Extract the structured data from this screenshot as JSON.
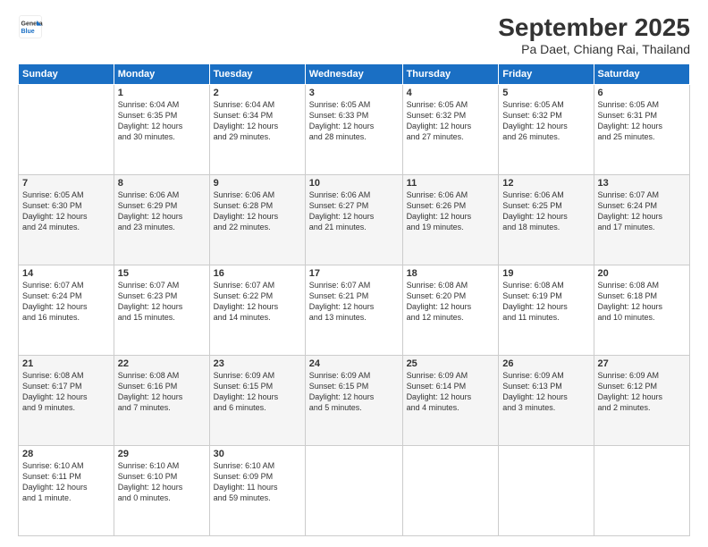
{
  "header": {
    "logo": {
      "line1": "General",
      "line2": "Blue"
    },
    "title": "September 2025",
    "subtitle": "Pa Daet, Chiang Rai, Thailand"
  },
  "days_of_week": [
    "Sunday",
    "Monday",
    "Tuesday",
    "Wednesday",
    "Thursday",
    "Friday",
    "Saturday"
  ],
  "weeks": [
    [
      {
        "day": "",
        "info": ""
      },
      {
        "day": "1",
        "info": "Sunrise: 6:04 AM\nSunset: 6:35 PM\nDaylight: 12 hours\nand 30 minutes."
      },
      {
        "day": "2",
        "info": "Sunrise: 6:04 AM\nSunset: 6:34 PM\nDaylight: 12 hours\nand 29 minutes."
      },
      {
        "day": "3",
        "info": "Sunrise: 6:05 AM\nSunset: 6:33 PM\nDaylight: 12 hours\nand 28 minutes."
      },
      {
        "day": "4",
        "info": "Sunrise: 6:05 AM\nSunset: 6:32 PM\nDaylight: 12 hours\nand 27 minutes."
      },
      {
        "day": "5",
        "info": "Sunrise: 6:05 AM\nSunset: 6:32 PM\nDaylight: 12 hours\nand 26 minutes."
      },
      {
        "day": "6",
        "info": "Sunrise: 6:05 AM\nSunset: 6:31 PM\nDaylight: 12 hours\nand 25 minutes."
      }
    ],
    [
      {
        "day": "7",
        "info": "Sunrise: 6:05 AM\nSunset: 6:30 PM\nDaylight: 12 hours\nand 24 minutes."
      },
      {
        "day": "8",
        "info": "Sunrise: 6:06 AM\nSunset: 6:29 PM\nDaylight: 12 hours\nand 23 minutes."
      },
      {
        "day": "9",
        "info": "Sunrise: 6:06 AM\nSunset: 6:28 PM\nDaylight: 12 hours\nand 22 minutes."
      },
      {
        "day": "10",
        "info": "Sunrise: 6:06 AM\nSunset: 6:27 PM\nDaylight: 12 hours\nand 21 minutes."
      },
      {
        "day": "11",
        "info": "Sunrise: 6:06 AM\nSunset: 6:26 PM\nDaylight: 12 hours\nand 19 minutes."
      },
      {
        "day": "12",
        "info": "Sunrise: 6:06 AM\nSunset: 6:25 PM\nDaylight: 12 hours\nand 18 minutes."
      },
      {
        "day": "13",
        "info": "Sunrise: 6:07 AM\nSunset: 6:24 PM\nDaylight: 12 hours\nand 17 minutes."
      }
    ],
    [
      {
        "day": "14",
        "info": "Sunrise: 6:07 AM\nSunset: 6:24 PM\nDaylight: 12 hours\nand 16 minutes."
      },
      {
        "day": "15",
        "info": "Sunrise: 6:07 AM\nSunset: 6:23 PM\nDaylight: 12 hours\nand 15 minutes."
      },
      {
        "day": "16",
        "info": "Sunrise: 6:07 AM\nSunset: 6:22 PM\nDaylight: 12 hours\nand 14 minutes."
      },
      {
        "day": "17",
        "info": "Sunrise: 6:07 AM\nSunset: 6:21 PM\nDaylight: 12 hours\nand 13 minutes."
      },
      {
        "day": "18",
        "info": "Sunrise: 6:08 AM\nSunset: 6:20 PM\nDaylight: 12 hours\nand 12 minutes."
      },
      {
        "day": "19",
        "info": "Sunrise: 6:08 AM\nSunset: 6:19 PM\nDaylight: 12 hours\nand 11 minutes."
      },
      {
        "day": "20",
        "info": "Sunrise: 6:08 AM\nSunset: 6:18 PM\nDaylight: 12 hours\nand 10 minutes."
      }
    ],
    [
      {
        "day": "21",
        "info": "Sunrise: 6:08 AM\nSunset: 6:17 PM\nDaylight: 12 hours\nand 9 minutes."
      },
      {
        "day": "22",
        "info": "Sunrise: 6:08 AM\nSunset: 6:16 PM\nDaylight: 12 hours\nand 7 minutes."
      },
      {
        "day": "23",
        "info": "Sunrise: 6:09 AM\nSunset: 6:15 PM\nDaylight: 12 hours\nand 6 minutes."
      },
      {
        "day": "24",
        "info": "Sunrise: 6:09 AM\nSunset: 6:15 PM\nDaylight: 12 hours\nand 5 minutes."
      },
      {
        "day": "25",
        "info": "Sunrise: 6:09 AM\nSunset: 6:14 PM\nDaylight: 12 hours\nand 4 minutes."
      },
      {
        "day": "26",
        "info": "Sunrise: 6:09 AM\nSunset: 6:13 PM\nDaylight: 12 hours\nand 3 minutes."
      },
      {
        "day": "27",
        "info": "Sunrise: 6:09 AM\nSunset: 6:12 PM\nDaylight: 12 hours\nand 2 minutes."
      }
    ],
    [
      {
        "day": "28",
        "info": "Sunrise: 6:10 AM\nSunset: 6:11 PM\nDaylight: 12 hours\nand 1 minute."
      },
      {
        "day": "29",
        "info": "Sunrise: 6:10 AM\nSunset: 6:10 PM\nDaylight: 12 hours\nand 0 minutes."
      },
      {
        "day": "30",
        "info": "Sunrise: 6:10 AM\nSunset: 6:09 PM\nDaylight: 11 hours\nand 59 minutes."
      },
      {
        "day": "",
        "info": ""
      },
      {
        "day": "",
        "info": ""
      },
      {
        "day": "",
        "info": ""
      },
      {
        "day": "",
        "info": ""
      }
    ]
  ]
}
